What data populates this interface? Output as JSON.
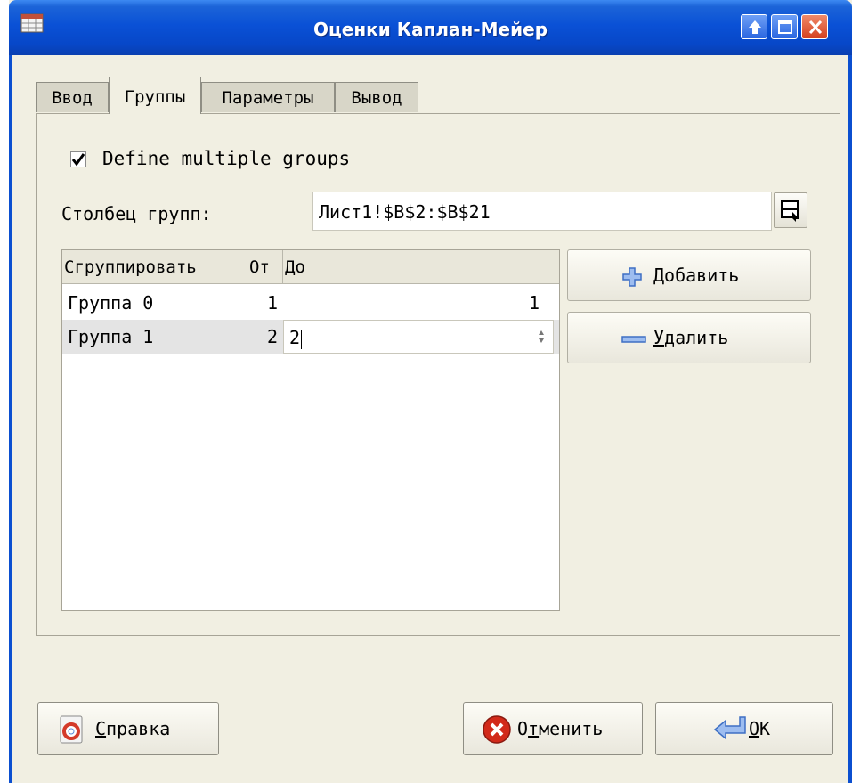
{
  "window": {
    "title": "Оценки Каплан-Мейер"
  },
  "tabs": [
    {
      "label": "Ввод"
    },
    {
      "label": "Группы"
    },
    {
      "label": "Параметры"
    },
    {
      "label": "Вывод"
    }
  ],
  "groups_tab": {
    "define_multiple": {
      "label": "Define multiple groups",
      "checked": true
    },
    "group_column": {
      "label": "Столбец групп:",
      "value": "Лист1!$B$2:$B$21"
    },
    "table": {
      "headers": [
        "Сгруппировать",
        "От",
        "До"
      ],
      "rows": [
        {
          "name": "Группа 0",
          "from": "1",
          "to": "1"
        },
        {
          "name": "Группа 1",
          "from": "2",
          "to": "2",
          "editing": true
        }
      ]
    },
    "add_button": {
      "mnemonic": "Д",
      "rest": "обавить"
    },
    "delete_button": {
      "mnemonic": "У",
      "rest": "далить"
    }
  },
  "footer": {
    "help_button": {
      "mnemonic": "С",
      "rest": "правка"
    },
    "cancel_button": {
      "pre": "О",
      "mnemonic": "т",
      "rest": "менить"
    },
    "ok_button": {
      "mnemonic": "O",
      "rest": "K"
    }
  },
  "colors": {
    "titlebar": "#0a51d6",
    "dialog_bg": "#f1efe2",
    "selected_row": "#e4e4e4",
    "add_icon": "#5a8ad8",
    "cancel_icon": "#d22a1a"
  }
}
